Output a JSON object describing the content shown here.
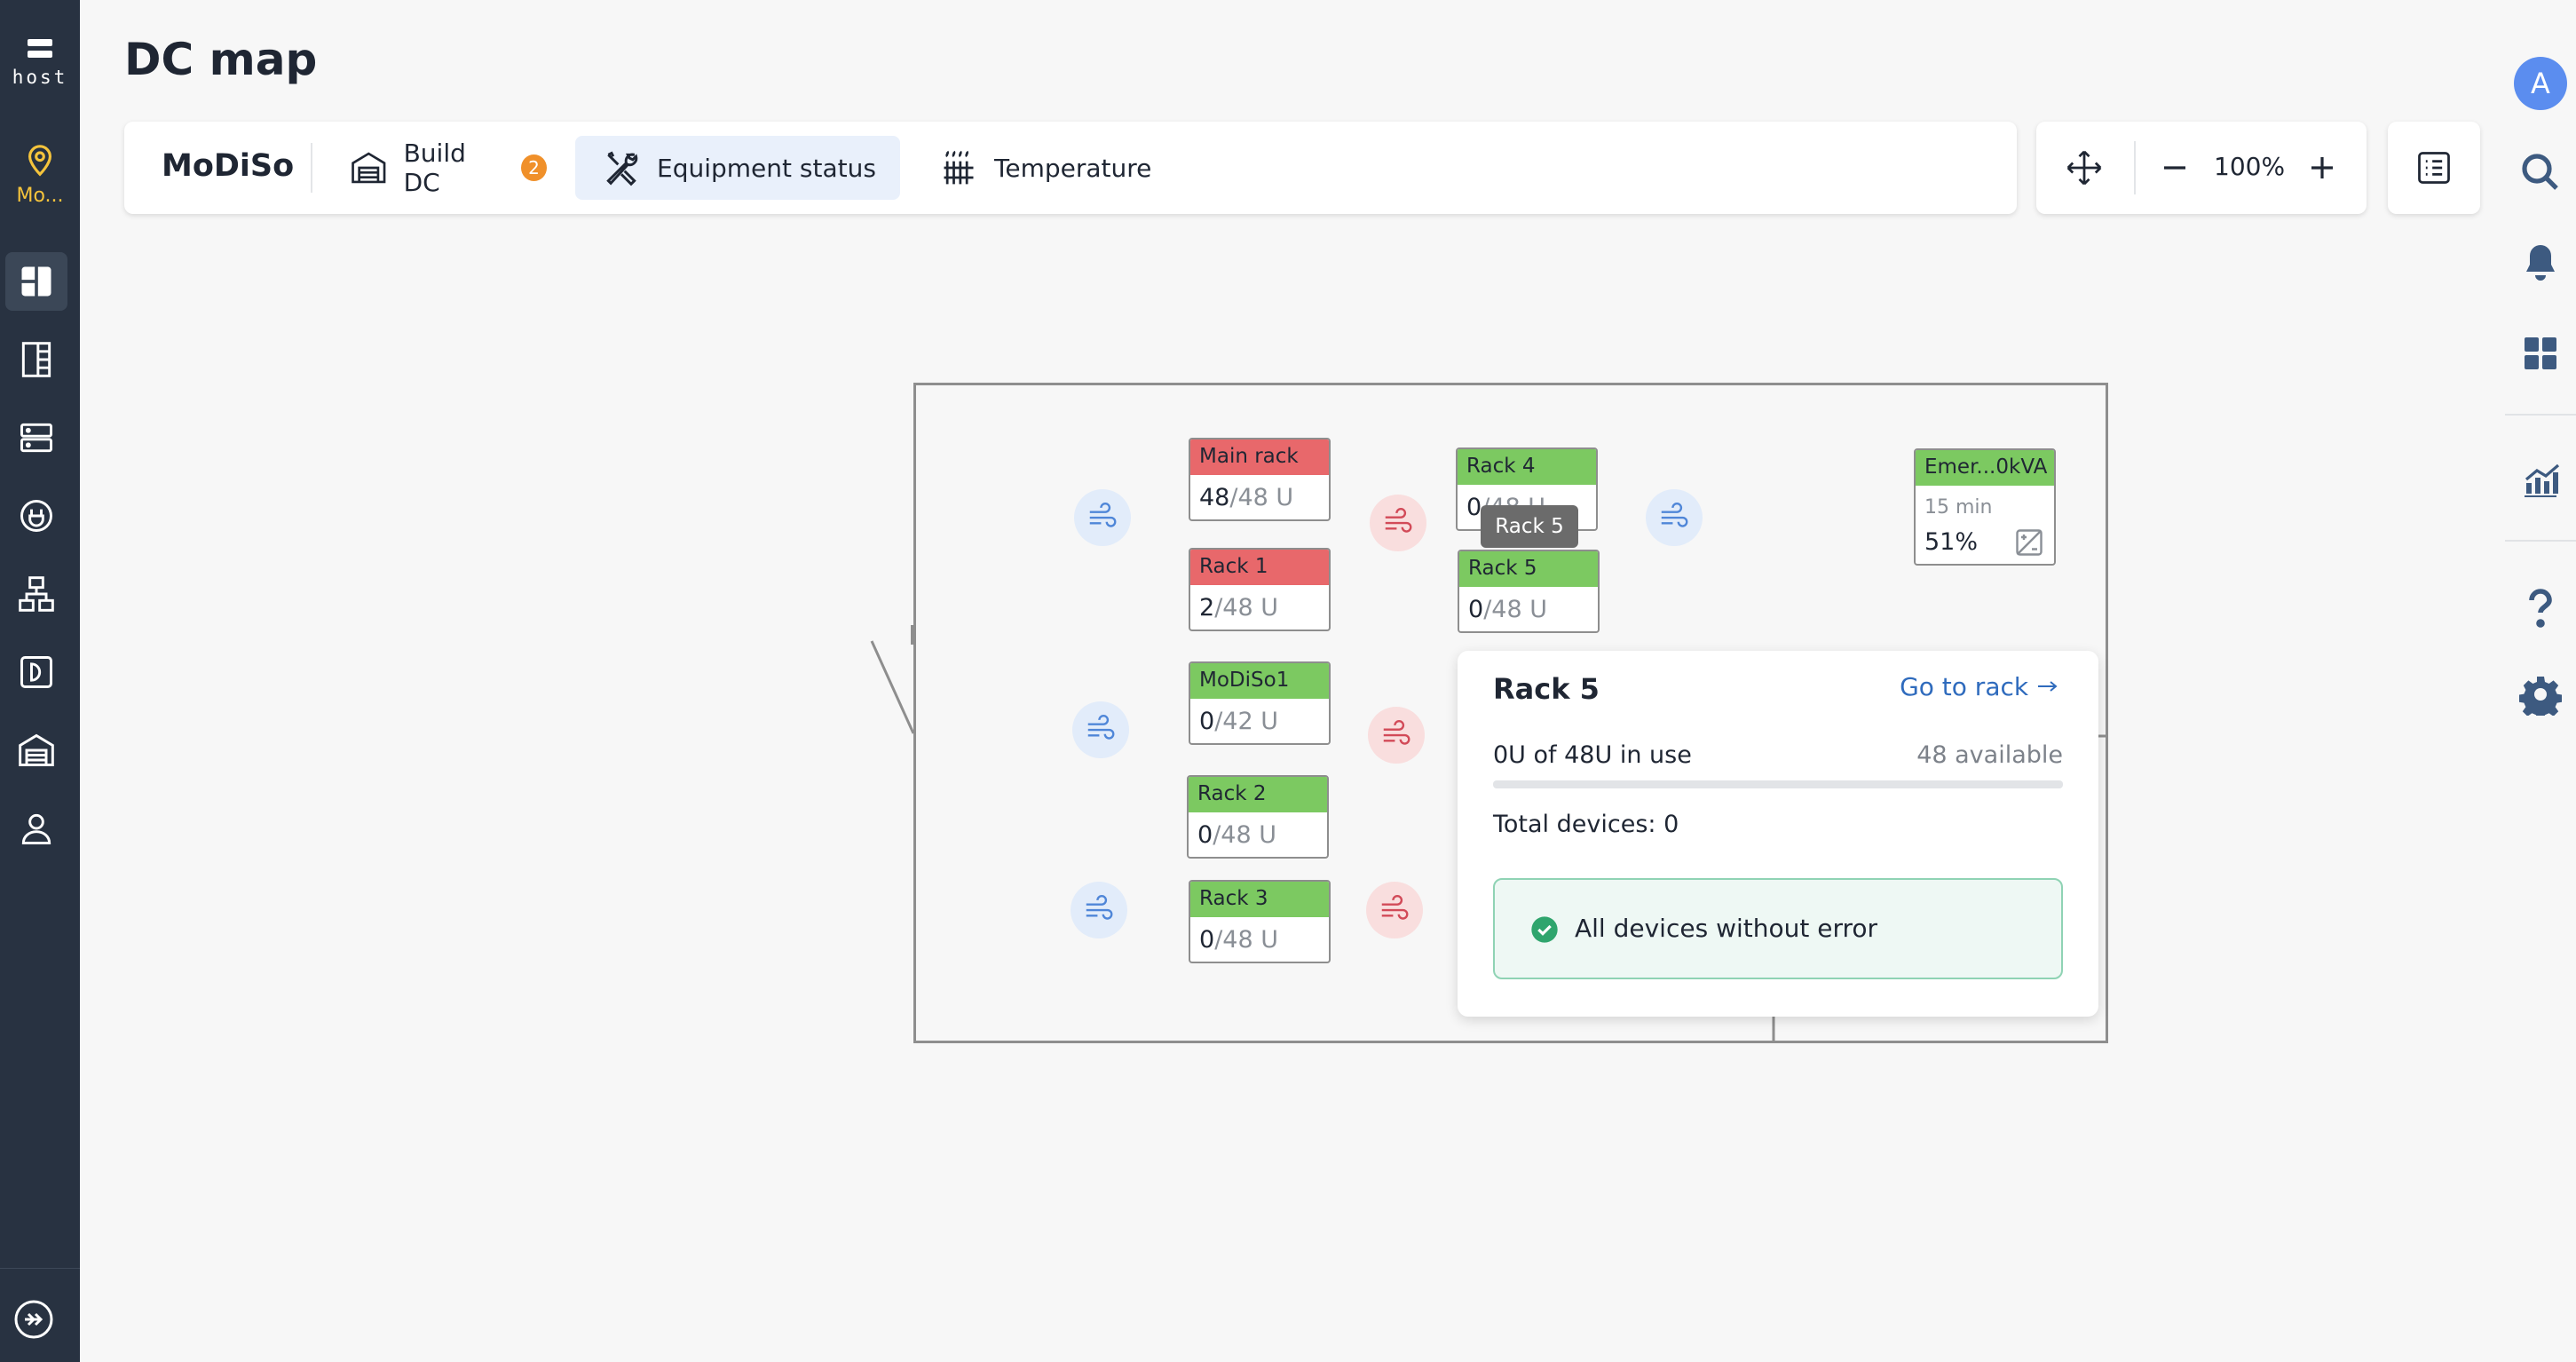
{
  "sidebar": {
    "logo_text": "host",
    "dc_selector_label": "Mo...",
    "items": [
      "dc-map",
      "racks",
      "devices",
      "power",
      "network",
      "storage",
      "buildings",
      "users"
    ]
  },
  "header": {
    "title": "DC map"
  },
  "toolbar": {
    "dc_name": "MoDiSo",
    "tabs": [
      {
        "label": "Build DC",
        "badge": "2",
        "icon": "building-icon"
      },
      {
        "label": "Equipment status",
        "icon": "tools-icon",
        "selected": true
      },
      {
        "label": "Temperature",
        "icon": "heater-icon"
      }
    ]
  },
  "zoom": {
    "level": "100%"
  },
  "user": {
    "avatar_letter": "A"
  },
  "map": {
    "racks": [
      {
        "name": "Main rack",
        "used": "48",
        "capacity": "/48 U",
        "status": "red"
      },
      {
        "name": "Rack 1",
        "used": "2",
        "capacity": "/48 U",
        "status": "red"
      },
      {
        "name": "MoDiSo1",
        "used": "0",
        "capacity": "/42 U",
        "status": "green"
      },
      {
        "name": "Rack 2",
        "used": "0",
        "capacity": "/48 U",
        "status": "green"
      },
      {
        "name": "Rack 3",
        "used": "0",
        "capacity": "/48 U",
        "status": "green"
      },
      {
        "name": "Rack 4",
        "used": "0",
        "capacity": "/48 U",
        "status": "green"
      },
      {
        "name": "Rack 5",
        "used": "0",
        "capacity": "/48 U",
        "status": "green"
      }
    ],
    "ups": {
      "name": "Emer...0kVA",
      "runtime": "15 min",
      "charge": "51%"
    },
    "tooltip": "Rack 5"
  },
  "popover": {
    "title": "Rack 5",
    "link": "Go to rack",
    "usage": "0U of 48U in use",
    "available": "48 available",
    "usage_fraction": 0,
    "devices": "Total devices: 0",
    "status": "All devices without error"
  },
  "colors": {
    "sidebar_bg": "#283241",
    "accent_blue": "#5b8def",
    "rack_error": "#e8686b",
    "rack_ok": "#7cc961",
    "badge": "#f0902a",
    "link": "#2f6bbd"
  }
}
